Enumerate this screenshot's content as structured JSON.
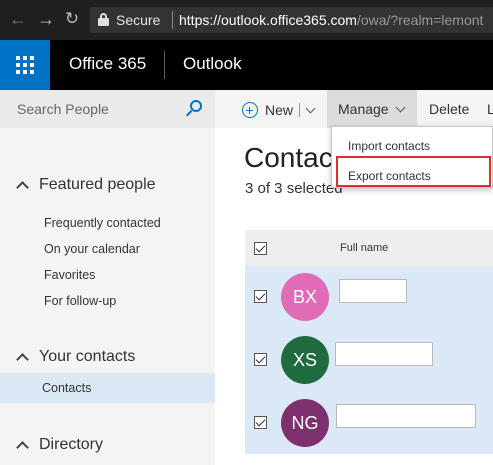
{
  "browser": {
    "secure_label": "Secure",
    "url_host": "https://outlook.office365.com",
    "url_path": "/owa/?realm=lemont"
  },
  "appbar": {
    "suite_name": "Office 365",
    "app_name": "Outlook",
    "brand_color": "#0072c6"
  },
  "sidebar": {
    "search_placeholder": "Search People",
    "sections": [
      {
        "label": "Featured people",
        "items": [
          "Frequently contacted",
          "On your calendar",
          "Favorites",
          "For follow-up"
        ]
      },
      {
        "label": "Your contacts",
        "items": [
          "Contacts"
        ]
      },
      {
        "label": "Directory",
        "items": []
      }
    ],
    "selected_item": "Contacts"
  },
  "toolbar": {
    "new_label": "New",
    "manage_label": "Manage",
    "delete_label": "Delete",
    "overflow_label": "L"
  },
  "manage_menu": {
    "items": [
      "Import contacts",
      "Export contacts"
    ],
    "highlighted": "Export contacts",
    "highlight_color": "#e22c34"
  },
  "main": {
    "title": "Contacts",
    "selection_status": "3 of 3 selected",
    "column_fullname": "Full name"
  },
  "contacts": [
    {
      "initials": "BX",
      "color": "#e06bb6",
      "checked": true
    },
    {
      "initials": "XS",
      "color": "#1f6b3f",
      "checked": true
    },
    {
      "initials": "NG",
      "color": "#7d2f6e",
      "checked": true
    }
  ]
}
